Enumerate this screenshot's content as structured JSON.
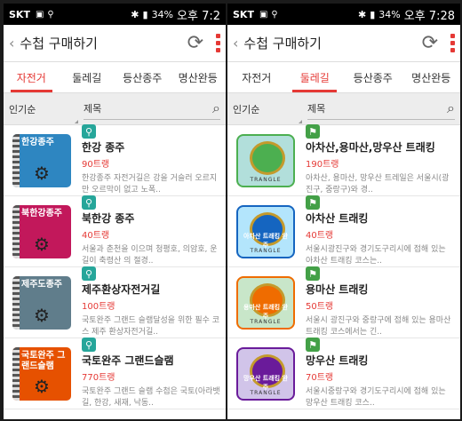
{
  "left": {
    "status": {
      "carrier": "SKT",
      "battery": "34%",
      "time": "오후 7:2"
    },
    "title": "수첩 구매하기",
    "tabs": [
      {
        "label": "자전거",
        "active": true
      },
      {
        "label": "둘레길"
      },
      {
        "label": "등산종주"
      },
      {
        "label": "명산완등"
      }
    ],
    "sort": "인기순",
    "search_placeholder": "제목",
    "items": [
      {
        "thumb": "한강종주",
        "name": "한강 종주",
        "price": "90트랭",
        "desc": "한강종주 자전거길은 강을 거슬러 오르지만 오르막이 없고 노폭..",
        "color": "#2e86c1"
      },
      {
        "thumb": "북한강종주",
        "name": "북한강 종주",
        "price": "40트랭",
        "desc": "서울과 춘천을 이으며 청평호, 의암호, 운길이 축령산 의 절경..",
        "color": "#c2185b"
      },
      {
        "thumb": "제주도종주",
        "name": "제주환상자전거길",
        "price": "100트랭",
        "desc": "국토완주 그랜드 슬램달성을 위한 필수 코스 제주 환상자전거길..",
        "color": "#607d8b"
      },
      {
        "thumb": "국토완주 그랜드슬램",
        "name": "국토완주 그랜드슬램",
        "price": "770트랭",
        "desc": "국토완주 그랜드 슬램 수첩은 국토(아라뱃길, 한강, 새재, 낙동..",
        "color": "#e65100"
      }
    ]
  },
  "right": {
    "status": {
      "carrier": "SKT",
      "battery": "34%",
      "time": "오후 7:28"
    },
    "title": "수첩 구매하기",
    "tabs": [
      {
        "label": "자전거"
      },
      {
        "label": "둘레길",
        "active": true
      },
      {
        "label": "등산종주"
      },
      {
        "label": "명산완등"
      }
    ],
    "sort": "인기순",
    "search_placeholder": "제목",
    "items": [
      {
        "name": "아차산,용마산,망우산 트래킹",
        "price": "190트랭",
        "desc": "아차산, 용마산, 망우산 트레일은 서울시(광진구, 중랑구)와 경..",
        "color": "#4caf50",
        "frame": "#b2dfdb",
        "brand": "TRANGLE"
      },
      {
        "name": "아차산 트래킹",
        "price": "40트랭",
        "desc": "서울시광진구와 경기도구리시에 접해 있는 아차산 트래킹 코스는..",
        "color": "#1565c0",
        "frame": "#b3e5fc",
        "label": "아차산 트래킹 완주",
        "brand": "TRANGLE"
      },
      {
        "name": "용마산 트래킹",
        "price": "50트랭",
        "desc": "서울시 광진구와 중랑구에 접해 있는 용마산 트래킹 코스에서는 긴..",
        "color": "#ef6c00",
        "frame": "#c8e6c9",
        "label": "용마산 트래킹 완주",
        "brand": "TRANGLE"
      },
      {
        "name": "망우산 트래킹",
        "price": "70트랭",
        "desc": "서울시중랑구와 경기도구리시에 접해 있는 망우산 트래킹 코스..",
        "color": "#6a1b9a",
        "frame": "#d1c4e9",
        "label": "망우산 트래킹 완주",
        "brand": "TRANGLE"
      }
    ]
  }
}
